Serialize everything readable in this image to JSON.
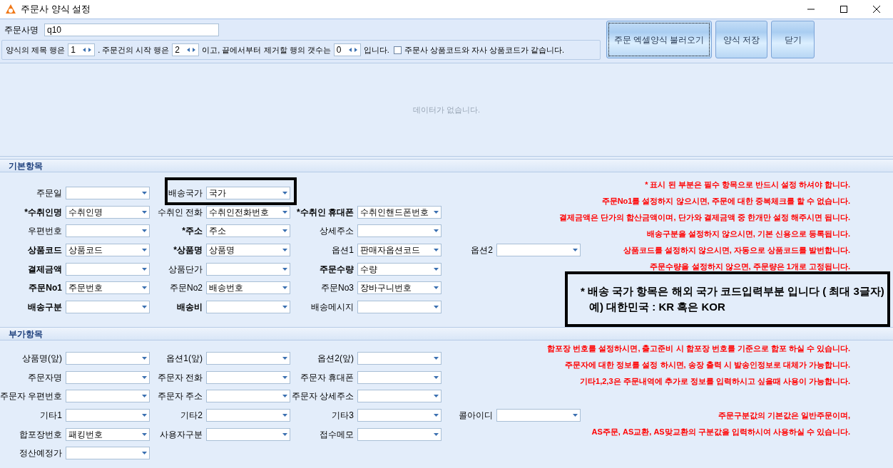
{
  "window": {
    "title": "주문사 양식 설정"
  },
  "customer": {
    "label": "주문사명",
    "value": "q10"
  },
  "options_line": [
    {
      "kind": "text",
      "text": "양식의 제목 행은"
    },
    {
      "kind": "spin",
      "value": "1"
    },
    {
      "kind": "text",
      "text": ". 주문건의 시작 행은"
    },
    {
      "kind": "spin",
      "value": "2"
    },
    {
      "kind": "text",
      "text": "이고, 끝에서부터 제거할 행의 갯수는"
    },
    {
      "kind": "spin",
      "value": "0"
    },
    {
      "kind": "text",
      "text": "입니다."
    },
    {
      "kind": "checkbox",
      "text": "주문사 상품코드와 자사 상품코드가 같습니다.",
      "checked": false
    }
  ],
  "buttons": [
    {
      "label": "주문 엑셀양식 불러오기",
      "focused": true
    },
    {
      "label": "양식 저장",
      "focused": false
    },
    {
      "label": "닫기",
      "focused": false
    }
  ],
  "grid": {
    "empty_text": "데이터가 없습니다."
  },
  "sections": [
    {
      "title": "기본항목",
      "rows": [
        [
          {
            "label": "주문일",
            "bold": false,
            "highlighted": false
          },
          {
            "label": "배송국가",
            "value": "국가",
            "bold": false,
            "highlighted": true
          }
        ],
        [
          {
            "label": "*수취인명",
            "value": "수취인명",
            "bold": true,
            "highlighted": false
          },
          {
            "label": "수취인 전화",
            "value": "수취인전화번호",
            "bold": false,
            "highlighted": false
          },
          {
            "label": "*수취인 휴대폰",
            "value": "수취인핸드폰번호",
            "bold": true,
            "highlighted": false
          }
        ],
        [
          {
            "label": "우편번호",
            "bold": false,
            "highlighted": false
          },
          {
            "label": "*주소",
            "value": "주소",
            "bold": true,
            "highlighted": false
          },
          {
            "label": "상세주소",
            "bold": false,
            "highlighted": false
          }
        ],
        [
          {
            "label": "상품코드",
            "value": "상품코드",
            "bold": true,
            "highlighted": false
          },
          {
            "label": "*상품명",
            "value": "상품명",
            "bold": true,
            "highlighted": false
          },
          {
            "label": "옵션1",
            "value": "판매자옵션코드",
            "bold": false,
            "highlighted": false
          },
          {
            "label": "옵션2",
            "bold": false,
            "highlighted": false
          }
        ],
        [
          {
            "label": "결제금액",
            "bold": true,
            "highlighted": false
          },
          {
            "label": "상품단가",
            "bold": false,
            "highlighted": false
          },
          {
            "label": "주문수량",
            "value": "수량",
            "bold": true,
            "highlighted": false
          }
        ],
        [
          {
            "label": "주문No1",
            "value": "주문번호",
            "bold": true,
            "highlighted": false
          },
          {
            "label": "주문No2",
            "value": "배송번호",
            "bold": false,
            "highlighted": false
          },
          {
            "label": "주문No3",
            "value": "장바구니번호",
            "bold": false,
            "highlighted": false
          }
        ],
        [
          {
            "label": "배송구분",
            "bold": true,
            "highlighted": false
          },
          {
            "label": "배송비",
            "bold": true,
            "highlighted": false
          },
          {
            "label": "배송메시지",
            "bold": false,
            "highlighted": false
          }
        ]
      ],
      "note_groups": [
        [
          "* 표시 된 부분은 필수 항목으로 반드시 설정 하셔야 합니다.",
          "주문No1를 설정하지 않으시면, 주문에 대한 중복체크를 할 수 없습니다.",
          "결제금액은 단가의 합산금액이며, 단가와 결제금액 중 한개만 설정 해주시면 됩니다.",
          "배송구분을 설정하지 않으시면, 기본 신용으로 등록됩니다.",
          "상품코드를 설정하지 않으시면, 자동으로 상품코드를 발번합니다.",
          "주문수량을 설정하지 않으면, 주문량은 1개로 고정됩니다."
        ]
      ]
    },
    {
      "title": "부가항목",
      "rows": [
        [
          {
            "label": "상품명(앞)",
            "bold": false,
            "highlighted": false
          },
          {
            "label": "옵션1(앞)",
            "bold": false,
            "highlighted": false
          },
          {
            "label": "옵션2(앞)",
            "bold": false,
            "highlighted": false
          }
        ],
        [
          {
            "label": "주문자명",
            "bold": false,
            "highlighted": false
          },
          {
            "label": "주문자 전화",
            "bold": false,
            "highlighted": false
          },
          {
            "label": "주문자 휴대폰",
            "bold": false,
            "highlighted": false
          }
        ],
        [
          {
            "label": "주문자 우편번호",
            "bold": false,
            "highlighted": false
          },
          {
            "label": "주문자 주소",
            "bold": false,
            "highlighted": false
          },
          {
            "label": "주문자 상세주소",
            "bold": false,
            "highlighted": false
          }
        ],
        [
          {
            "label": "기타1",
            "bold": false,
            "highlighted": false
          },
          {
            "label": "기타2",
            "bold": false,
            "highlighted": false
          },
          {
            "label": "기타3",
            "bold": false,
            "highlighted": false
          },
          {
            "label": "콜아이디",
            "bold": false,
            "highlighted": false
          }
        ],
        [
          {
            "label": "합포장번호",
            "value": "패킹번호",
            "bold": false,
            "highlighted": false
          },
          {
            "label": "사용자구분",
            "bold": false,
            "highlighted": false
          },
          {
            "label": "접수메모",
            "bold": false,
            "highlighted": false
          }
        ],
        [
          {
            "label": "정산예정가",
            "bold": false,
            "highlighted": false
          }
        ]
      ],
      "note_groups": [
        [
          "합포장 번호를 설정하시면, 출고준비 시 합포장 번호를 기준으로 합포 하실 수 있습니다.",
          "주문자에 대한 정보를 설정 하시면, 송장 출력 시 발송인정보로 대체가 가능합니다.",
          "기타1,2,3은 주문내역에 추가로 정보를 입력하시고 싶을때 사용이 가능합니다."
        ],
        [
          "주문구분값의 기본값은 일반주문이며,",
          "AS주문, AS교환, AS맞교환의 구분값을 입력하시여 사용하실 수 있습니다."
        ]
      ]
    }
  ],
  "callout": {
    "lines": [
      "* 배송 국가 항목은 해외 국가 코드입력부분 입니다 ( 최대 3글자)",
      "예) 대한민국 : KR 혹은 KOR"
    ]
  }
}
